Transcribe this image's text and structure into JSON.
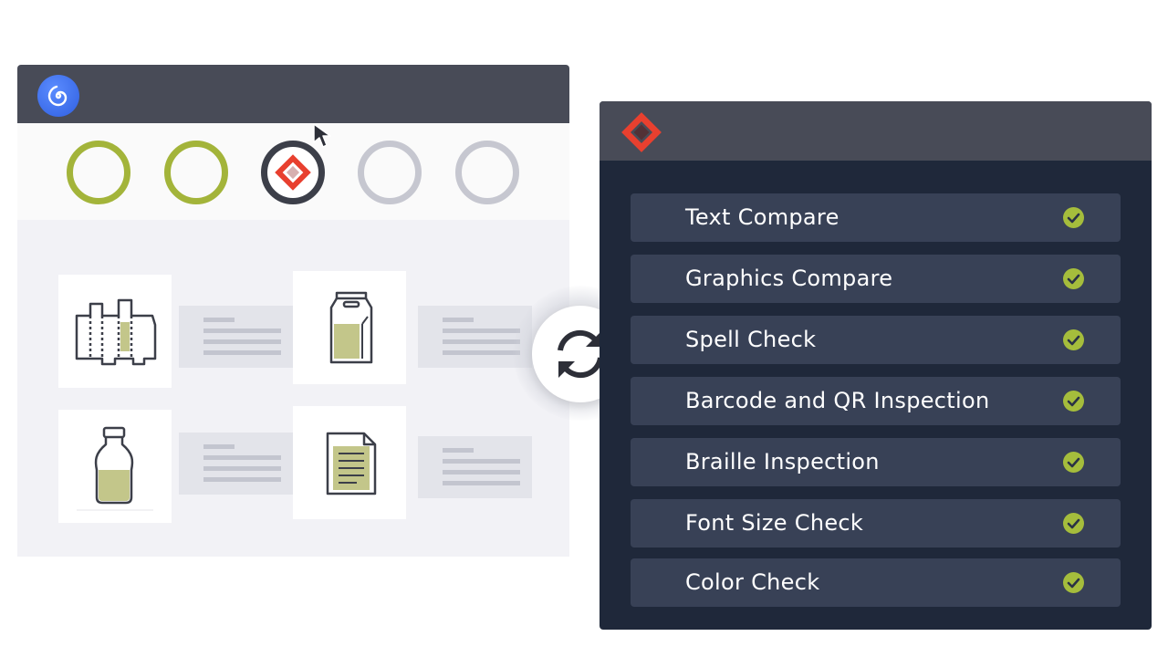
{
  "left_window": {
    "logo_icon": "spiral-logo-icon",
    "steps": [
      {
        "state": "done"
      },
      {
        "state": "done"
      },
      {
        "state": "active",
        "icon": "diamond-logo-icon"
      },
      {
        "state": "pending"
      },
      {
        "state": "pending"
      }
    ],
    "cards": [
      {
        "icon": "box-dieline-icon"
      },
      {
        "icon": "bag-package-icon"
      },
      {
        "icon": "bottle-icon"
      },
      {
        "icon": "document-icon"
      }
    ]
  },
  "sync": {
    "icon": "sync-arrows-icon"
  },
  "right_window": {
    "logo_icon": "diamond-logo-icon",
    "checks": [
      {
        "label": "Text Compare",
        "status": "passed"
      },
      {
        "label": "Graphics Compare",
        "status": "passed"
      },
      {
        "label": "Spell Check",
        "status": "passed"
      },
      {
        "label": "Barcode and QR Inspection",
        "status": "passed"
      },
      {
        "label": "Braille Inspection",
        "status": "passed"
      },
      {
        "label": "Font Size Check",
        "status": "passed"
      },
      {
        "label": "Color Check",
        "status": "passed"
      }
    ]
  },
  "colors": {
    "titlebar": "#484b57",
    "panel_dark": "#1f283a",
    "row": "#384156",
    "accent_green": "#a3b43a",
    "check_green": "#a5bd3c",
    "brand_red": "#e8402f",
    "brand_blue": "#3d6cf0"
  }
}
